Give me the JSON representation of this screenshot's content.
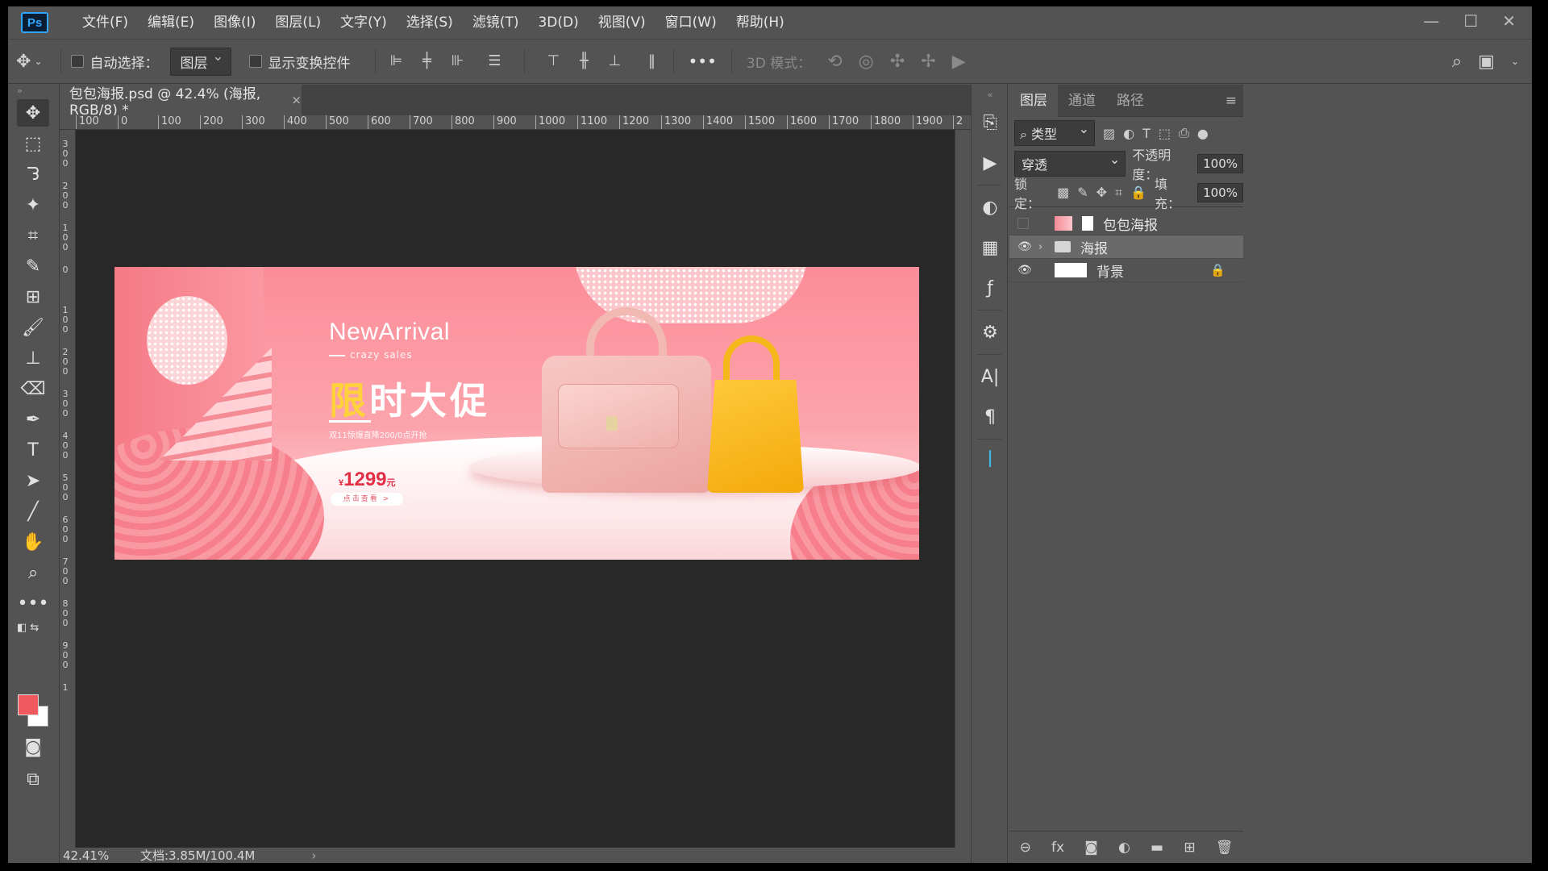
{
  "app": {
    "logo": "Ps",
    "menu": [
      "文件(F)",
      "编辑(E)",
      "图像(I)",
      "图层(L)",
      "文字(Y)",
      "选择(S)",
      "滤镜(T)",
      "3D(D)",
      "视图(V)",
      "窗口(W)",
      "帮助(H)"
    ],
    "window_controls": {
      "minimize": "—",
      "maximize": "☐",
      "close": "✕"
    }
  },
  "options": {
    "auto_select_label": "自动选择：",
    "auto_select_target": "图层",
    "show_transform_label": "显示变换控件",
    "more": "•••",
    "mode_3d_label": "3D 模式："
  },
  "document": {
    "tab_title": "包包海报.psd @ 42.4% (海报, RGB/8) *",
    "close": "×",
    "zoom": "42.41%",
    "doc_info": "文档:3.85M/100.4M",
    "status_arrow": "›"
  },
  "rulers": {
    "horizontal": [
      "100",
      "0",
      "100",
      "200",
      "300",
      "400",
      "500",
      "600",
      "700",
      "800",
      "900",
      "1000",
      "1100",
      "1200",
      "1300",
      "1400",
      "1500",
      "1600",
      "1700",
      "1800",
      "1900",
      "2"
    ],
    "vertical": [
      "300",
      "200",
      "100",
      "0",
      "100",
      "200",
      "300",
      "400",
      "500",
      "600",
      "700",
      "800",
      "900",
      "1"
    ]
  },
  "poster": {
    "headline_en": "NewArrival",
    "sub_en": "crazy sales",
    "headline_cn_1": "限",
    "headline_cn_2": "时",
    "headline_cn_3": "大促",
    "promo": "双11惊爆直降200/0点开抢",
    "price_currency": "¥",
    "price": "1299",
    "price_unit": "元",
    "cta": "点击查看 >"
  },
  "layers_panel": {
    "tabs": [
      "图层",
      "通道",
      "路径"
    ],
    "active_tab": "图层",
    "filter": "类型",
    "blend_mode": "穿透",
    "opacity_label": "不透明度：",
    "opacity": "100%",
    "lock_label": "锁定：",
    "fill_label": "填充：",
    "fill": "100%",
    "layers": [
      {
        "name": "包包海报",
        "visible": false,
        "type": "smart-object"
      },
      {
        "name": "海报",
        "visible": true,
        "type": "group",
        "selected": true
      },
      {
        "name": "背景",
        "visible": true,
        "type": "background",
        "locked": true
      }
    ]
  },
  "colors": {
    "foreground": "#f0595e",
    "background": "#ffffff",
    "ps_accent": "#31a8ff"
  }
}
